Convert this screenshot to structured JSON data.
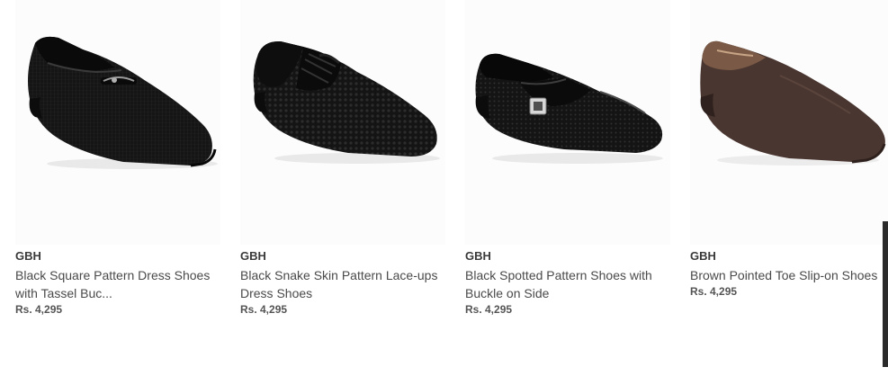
{
  "products": [
    {
      "brand": "GBH",
      "title": "Black Square Pattern Dress Shoes with Tassel Buc...",
      "price": "Rs. 4,295",
      "image_icon": "black-square-pattern-shoe-image"
    },
    {
      "brand": "GBH",
      "title": "Black Snake Skin Pattern Lace-ups Dress Shoes",
      "price": "Rs. 4,295",
      "image_icon": "black-snake-skin-lace-up-shoe-image"
    },
    {
      "brand": "GBH",
      "title": "Black Spotted Pattern Shoes with Buckle on Side",
      "price": "Rs. 4,295",
      "image_icon": "black-spotted-buckle-shoe-image"
    },
    {
      "brand": "GBH",
      "title": "Brown Pointed Toe Slip-on Shoes",
      "price": "Rs. 4,295",
      "image_icon": "brown-slip-on-shoe-image"
    }
  ],
  "colors": {
    "shoe_black": "#141414",
    "shoe_brown": "#4a3630",
    "brand_text": "#3a3a3a",
    "title_text": "#4a4a4a",
    "price_text": "#555555"
  }
}
